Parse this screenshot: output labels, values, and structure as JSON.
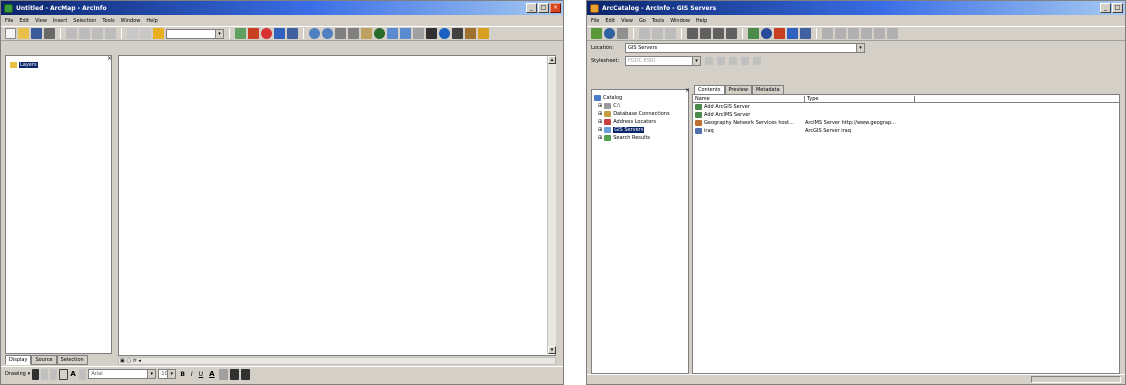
{
  "arcmap": {
    "title": "Untitled - ArcMap - ArcInfo",
    "menu": [
      "File",
      "Edit",
      "View",
      "Insert",
      "Selection",
      "Tools",
      "Window",
      "Help"
    ],
    "scale_value": "",
    "toc_root": "Layers",
    "toc_tabs": [
      "Display",
      "Source",
      "Selection"
    ],
    "drawing_label": "Drawing",
    "font_name": "Arial",
    "font_size": "10",
    "text_btns": [
      "B",
      "I",
      "U",
      "A"
    ]
  },
  "arccatalog": {
    "title": "ArcCatalog - ArcInfo - GIS Servers",
    "menu": [
      "File",
      "Edit",
      "View",
      "Go",
      "Tools",
      "Window",
      "Help"
    ],
    "location_label": "Location:",
    "location_value": "GIS Servers",
    "stylesheet_label": "Stylesheet:",
    "stylesheet_value": "FGDC ESRI",
    "tree": [
      {
        "label": "Catalog",
        "color": "#4a7bc8"
      },
      {
        "label": "C:\\",
        "color": "#9a9a9a"
      },
      {
        "label": "Database Connections",
        "color": "#c8a040"
      },
      {
        "label": "Address Locators",
        "color": "#c84040"
      },
      {
        "label": "GIS Servers",
        "color": "#6aa0d8"
      },
      {
        "label": "Search Results",
        "color": "#50a050"
      }
    ],
    "tabs": [
      "Contents",
      "Preview",
      "Metadata"
    ],
    "columns": [
      "Name",
      "Type"
    ],
    "rows": [
      {
        "name": "Add ArcGIS Server",
        "type": "",
        "color": "#4a8a4a"
      },
      {
        "name": "Add ArcIMS Server",
        "type": "",
        "color": "#4a8a4a"
      },
      {
        "name": "Geography Network Services host...",
        "type": "ArcIMS Server  http://www.geograp...",
        "color": "#c07030"
      },
      {
        "name": "iraq",
        "type": "ArcGIS Server  iraq",
        "color": "#5070b0"
      }
    ]
  },
  "colors": {
    "title_start": "#0a246a",
    "title_end": "#a6caf0",
    "chrome": "#d4d0c8",
    "selected": "#0a246a"
  }
}
